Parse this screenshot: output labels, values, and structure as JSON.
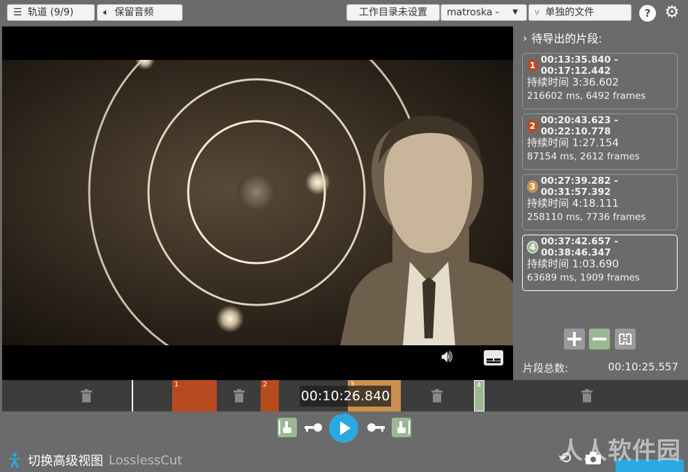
{
  "topbar": {
    "tracks_label": "轨道 (9/9)",
    "audio_label": "保留音频",
    "workdir_label": "工作目录未设置",
    "format_label": "matroska -",
    "export_mode_label": "单独的文件",
    "help_symbol": "?"
  },
  "sidebar": {
    "title": "待导出的片段:",
    "segments": [
      {
        "number": "1",
        "range": "00:13:35.840 - 00:17:12.442",
        "duration": "持续时间 3:36.602",
        "detail": "216602 ms, 6492 frames",
        "color": "#b84a20"
      },
      {
        "number": "2",
        "range": "00:20:43.623 - 00:22:10.778",
        "duration": "持续时间 1:27.154",
        "detail": "87154 ms, 2612 frames",
        "color": "#b84a20"
      },
      {
        "number": "3",
        "range": "00:27:39.282 - 00:31:57.392",
        "duration": "持续时间 4:18.111",
        "detail": "258110 ms, 7736 frames",
        "color": "#c9904e"
      },
      {
        "number": "4",
        "range": "00:37:42.657 - 00:38:46.347",
        "duration": "持续时间 1:03.690",
        "detail": "63689 ms, 1909 frames",
        "color": "#9cb893"
      }
    ],
    "total_label": "片段总数:",
    "total_value": "00:10:25.557"
  },
  "timeline": {
    "current_time": "00:10:26.840",
    "segment_labels": [
      "1",
      "2",
      "3",
      "4"
    ]
  },
  "footer": {
    "simple_view_label": "切换高级视图",
    "app_name": "LosslessCut",
    "watermark": "人人软件园"
  }
}
